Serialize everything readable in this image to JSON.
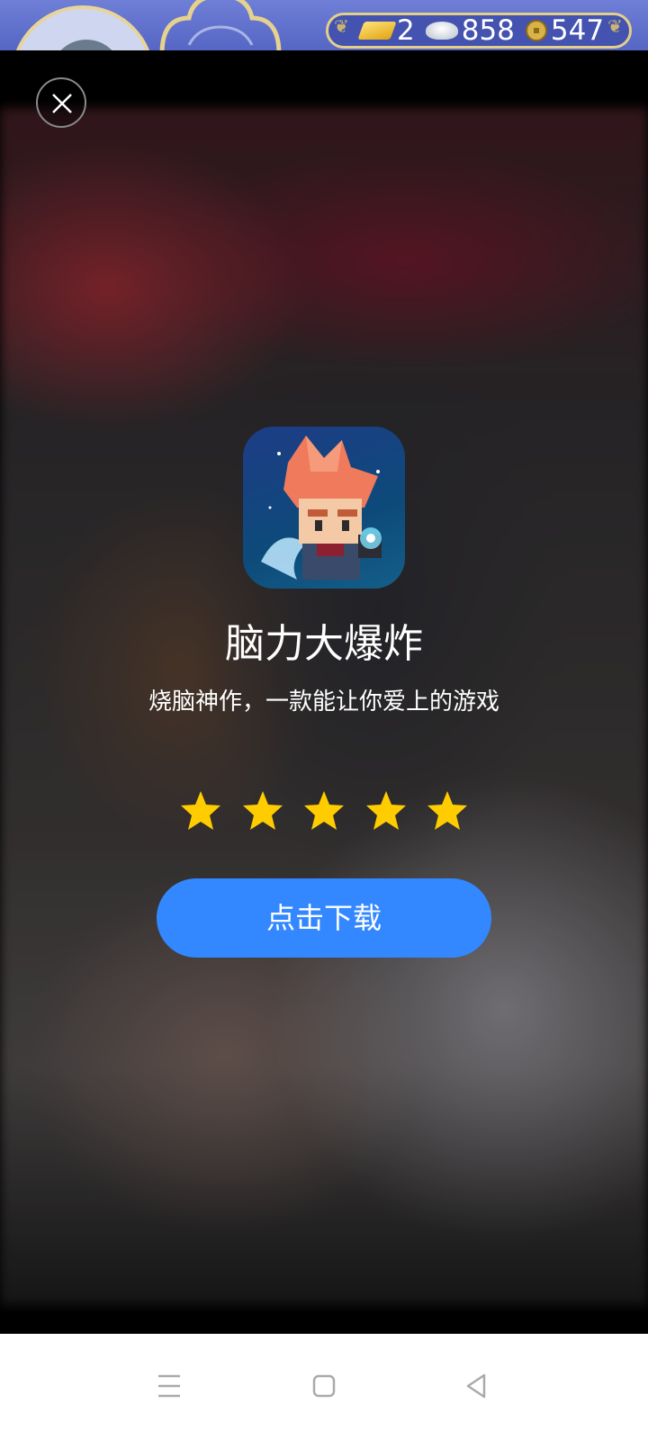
{
  "currency": {
    "gold": "2",
    "silver": "858",
    "coins": "547"
  },
  "ad": {
    "app_name": "脑力大爆炸",
    "description": "烧脑神作，一款能让你爱上的游戏",
    "rating": 5,
    "download_label": "点击下载"
  },
  "colors": {
    "accent": "#3388ff",
    "star": "#ffcc00"
  },
  "icons": [
    "close-icon",
    "gold-bar-icon",
    "silver-ingot-icon",
    "copper-coin-icon",
    "star-icon",
    "menu-icon",
    "home-icon",
    "back-icon"
  ]
}
